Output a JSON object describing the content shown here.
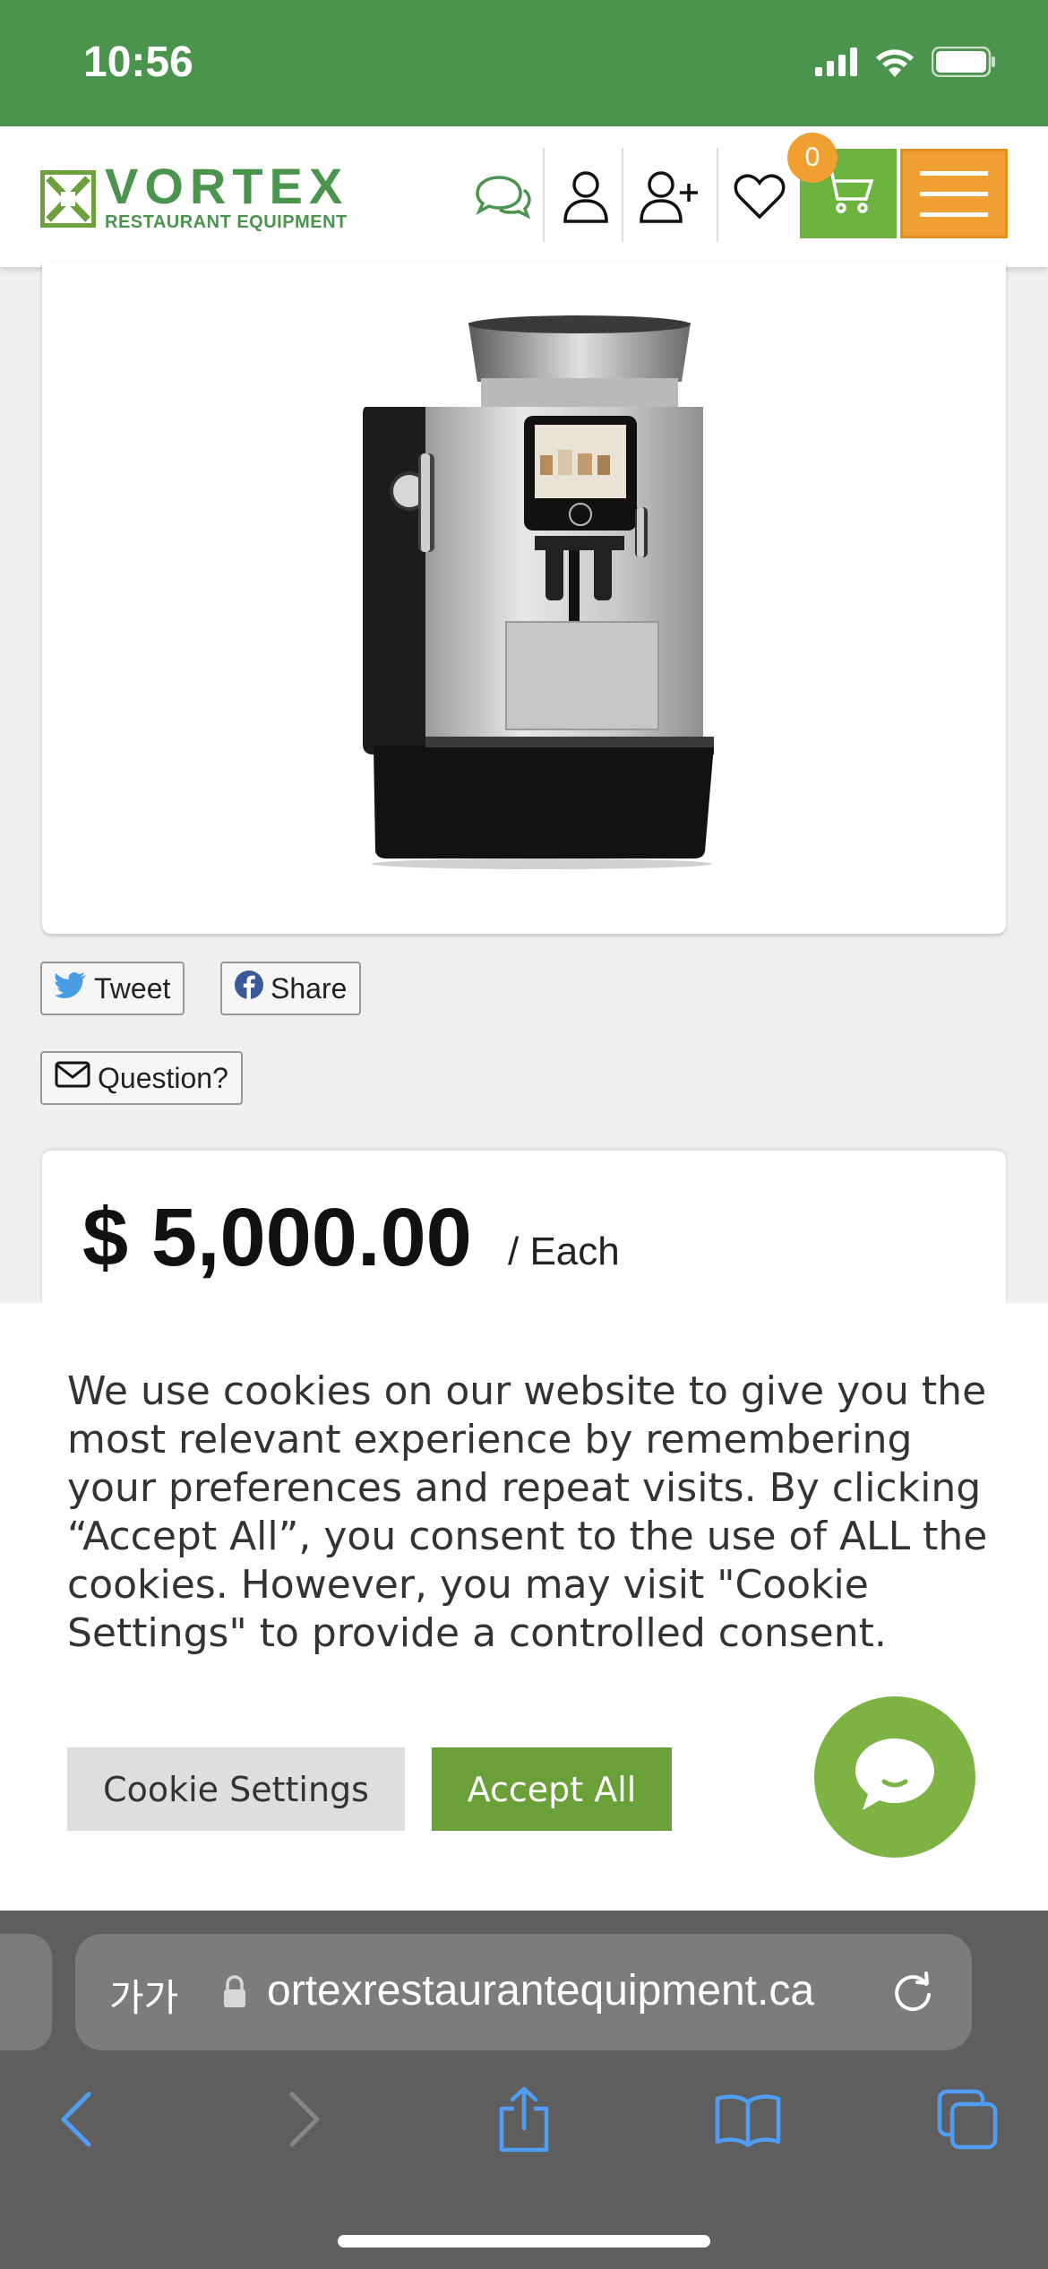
{
  "status_bar": {
    "time": "10:56",
    "icons": [
      "signal-icon",
      "wifi-icon",
      "battery-icon"
    ]
  },
  "header": {
    "logo_name": "VORTEX",
    "logo_subtitle": "RESTAURANT EQUIPMENT",
    "icons": [
      "chat-icon",
      "user-icon",
      "add-user-icon",
      "heart-icon",
      "cart-icon",
      "menu-icon"
    ],
    "cart_count": "0"
  },
  "product": {
    "image_alt": "espresso-machine",
    "tweet_label": "Tweet",
    "share_label": "Share",
    "question_label": "Question?",
    "price": "$ 5,000.00",
    "price_unit": "/ Each"
  },
  "cookie": {
    "text": "We use cookies on our website to give you the most relevant experience by remembering your preferences and repeat visits. By clicking “Accept All”, you consent to the use of ALL the cookies. However, you may visit \"Cookie Settings\" to provide a controlled consent.",
    "settings_label": "Cookie Settings",
    "accept_label": "Accept All"
  },
  "browser": {
    "aa_label": "가가",
    "url": "ortexrestaurantequipment.ca",
    "nav_icons": [
      "back-icon",
      "forward-icon",
      "share-icon",
      "bookmarks-icon",
      "tabs-icon"
    ]
  },
  "colors": {
    "brand_green": "#4b944d",
    "accent_green": "#6aa038",
    "accent_orange": "#f0a030"
  }
}
